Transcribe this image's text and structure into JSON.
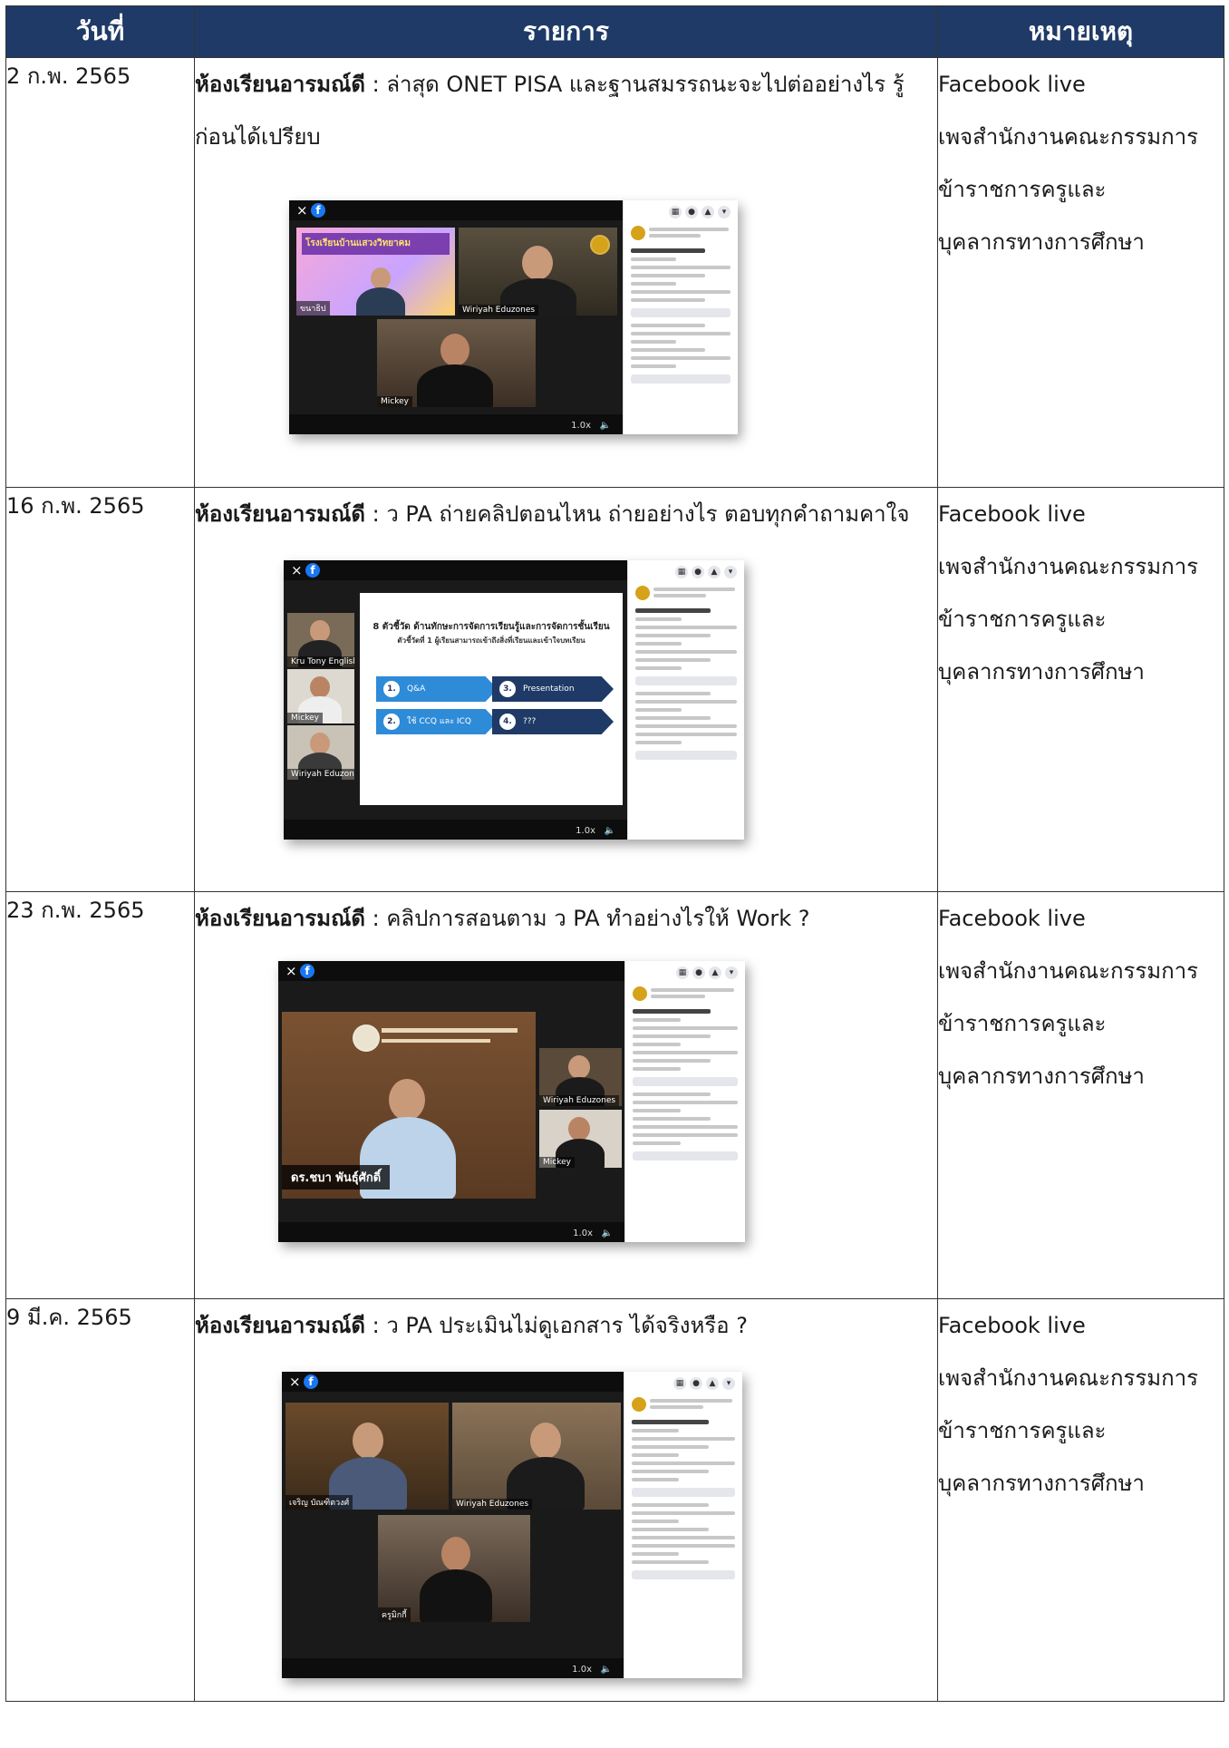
{
  "table": {
    "headers": {
      "date": "วันที่",
      "item": "รายการ",
      "note": "หมายเหตุ"
    },
    "rows": [
      {
        "date": "2 ก.พ. 2565",
        "bold": "ห้องเรียนอารมณ์ดี",
        "text": " :  ล่าสุด ONET PISA และฐานสมรรถนะจะไปต่ออย่างไร รู้ก่อนได้เปรียบ",
        "note": [
          "Facebook live",
          "เพจสำนักงานคณะกรรมการ",
          "ข้าราชการครูและ",
          "บุคลากรทางการศึกษา"
        ],
        "participants": [
          "ขนาธิป",
          "Wiriyah Eduzones",
          "Mickey"
        ],
        "banner": "โรงเรียนบ้านแสวงวิทยาคม"
      },
      {
        "date": "16 ก.พ. 2565",
        "bold": "ห้องเรียนอารมณ์ดี",
        "text": " : ว PA ถ่ายคลิปตอนไหน ถ่ายอย่างไร ตอบทุกคำถามคาใจ",
        "note": [
          "Facebook live",
          "เพจสำนักงานคณะกรรมการ",
          "ข้าราชการครูและ",
          "บุคลากรทางการศึกษา"
        ],
        "participants": [
          "Kru Tony English",
          "Mickey",
          "Wiriyah Eduzones"
        ],
        "slide_title": "8 ตัวชี้วัด ด้านทักษะการจัดการเรียนรู้และการจัดการชั้นเรียน",
        "slide_sub": "ตัวชี้วัดที่ 1 ผู้เรียนสามารถเข้าถึงสิ่งที่เรียนและเข้าใจบทเรียน",
        "steps": [
          {
            "n": "1.",
            "label": "Q&A"
          },
          {
            "n": "2.",
            "label": "ใช้ CCQ และ ICQ"
          },
          {
            "n": "3.",
            "label": "Presentation"
          },
          {
            "n": "4.",
            "label": "???"
          }
        ]
      },
      {
        "date": "23 ก.พ. 2565",
        "bold": "ห้องเรียนอารมณ์ดี",
        "text": " : คลิปการสอนตาม ว PA ทำอย่างไรให้ Work ?",
        "note": [
          "Facebook live",
          "เพจสำนักงานคณะกรรมการ",
          "ข้าราชการครูและ",
          "บุคลากรทางการศึกษา"
        ],
        "participants": [
          "ดร.ชบา พันธุ์ศักดิ์",
          "Wiriyah Eduzones",
          "Mickey"
        ]
      },
      {
        "date": "9 มี.ค. 2565",
        "bold": "ห้องเรียนอารมณ์ดี",
        "text": " : ว PA ประเมินไม่ดูเอกสาร ได้จริงหรือ ?",
        "note": [
          "Facebook live",
          "เพจสำนักงานคณะกรรมการ",
          "ข้าราชการครูและ",
          "บุคลากรทางการศึกษา"
        ],
        "participants": [
          "เจริญ บัณฑิตวงศ์",
          "Wiriyah Eduzones",
          "ครูมิกกี้"
        ]
      }
    ]
  },
  "player": {
    "close": "×",
    "fb": "f",
    "speed": "1.0x",
    "volume": "🔈"
  },
  "colors": {
    "header_bg": "#1f3a66",
    "fb_blue": "#1877f2",
    "arrow_light": "#2e8bd8",
    "arrow_dark": "#1f3a66"
  }
}
